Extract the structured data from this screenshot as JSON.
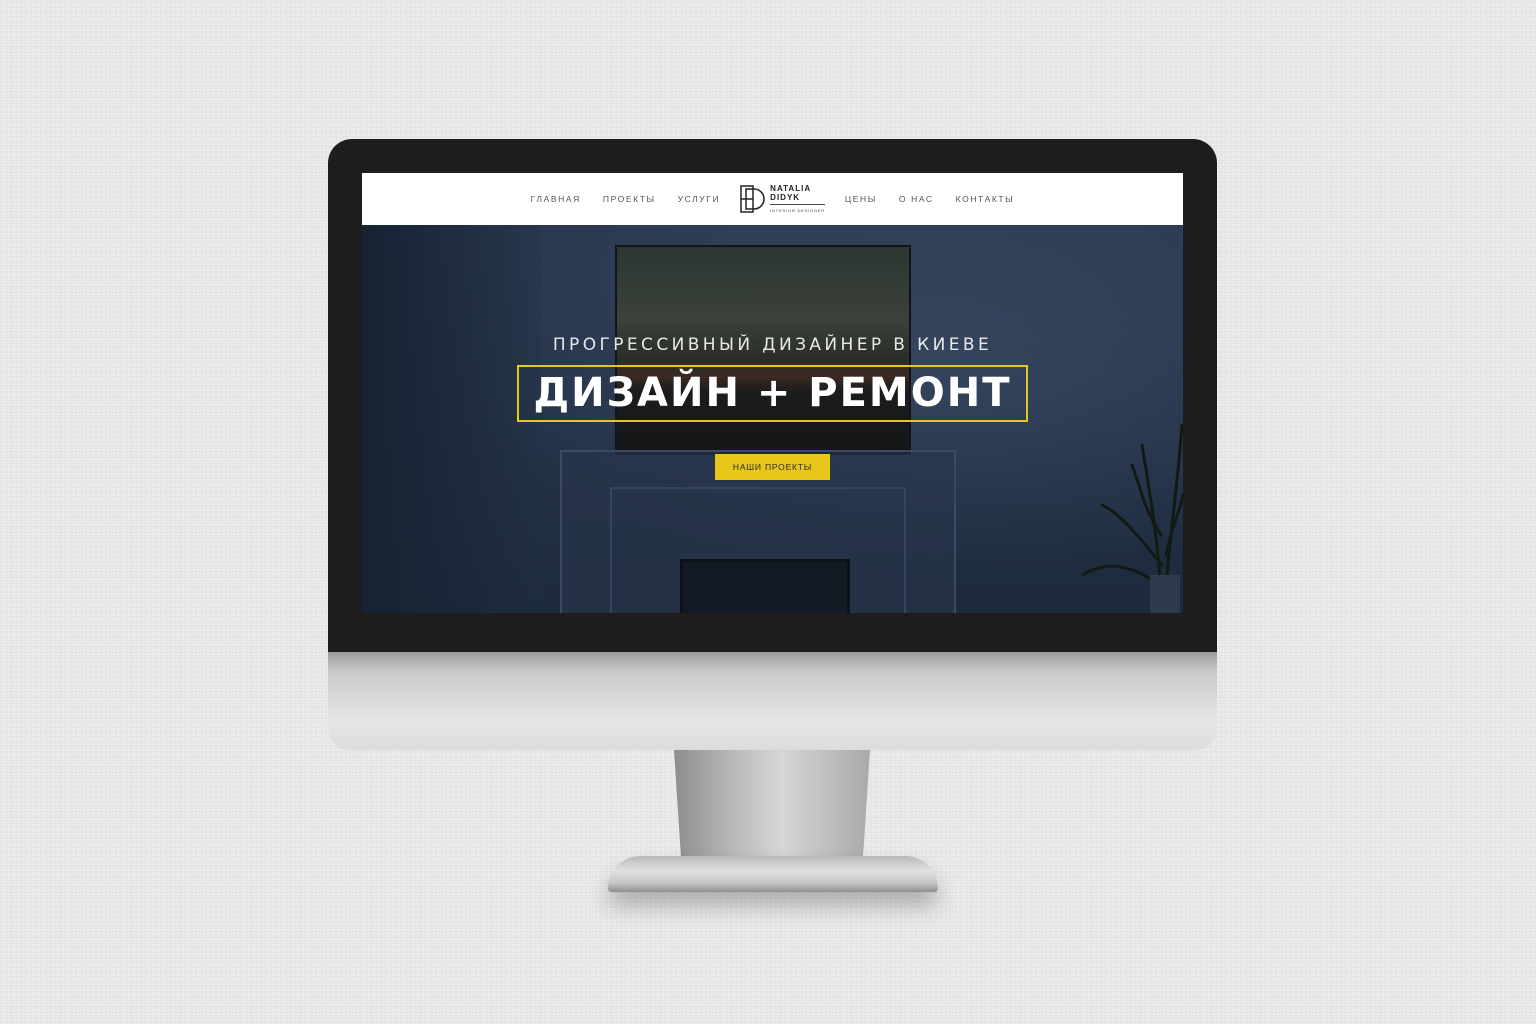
{
  "nav": {
    "left": [
      "ГЛАВНАЯ",
      "ПРОЕКТЫ",
      "УСЛУГИ"
    ],
    "right": [
      "ЦЕНЫ",
      "О НАС",
      "КОНТАКТЫ"
    ]
  },
  "logo": {
    "line1": "NATALIA",
    "line2": "DIDYK",
    "subtitle": "INTERIOR DESIGNER"
  },
  "hero": {
    "tagline": "ПРОГРЕССИВНЫЙ ДИЗАЙНЕР В КИЕВЕ",
    "headline": "ДИЗАЙН + РЕМОНТ",
    "cta_label": "НАШИ ПРОЕКТЫ"
  },
  "colors": {
    "accent": "#e8c61a",
    "hero_bg": "#26344a",
    "nav_bg": "#ffffff"
  }
}
